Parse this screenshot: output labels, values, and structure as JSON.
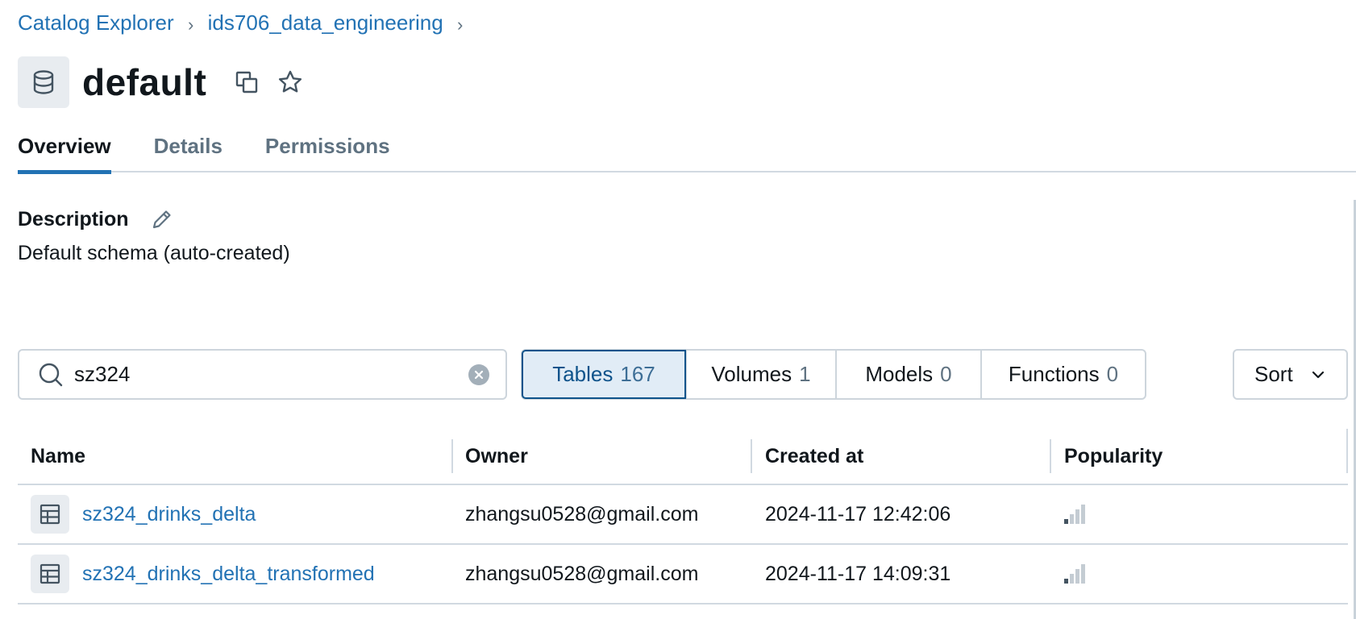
{
  "breadcrumb": {
    "items": [
      "Catalog Explorer",
      "ids706_data_engineering"
    ]
  },
  "header": {
    "title": "default",
    "icon": "database-icon",
    "actions": [
      "copy-icon",
      "star-icon"
    ]
  },
  "tabs": [
    {
      "label": "Overview",
      "active": true
    },
    {
      "label": "Details",
      "active": false
    },
    {
      "label": "Permissions",
      "active": false
    }
  ],
  "description": {
    "heading": "Description",
    "text": "Default schema (auto-created)"
  },
  "search": {
    "value": "sz324",
    "placeholder": ""
  },
  "filters": [
    {
      "label": "Tables",
      "count": "167",
      "active": true
    },
    {
      "label": "Volumes",
      "count": "1",
      "active": false
    },
    {
      "label": "Models",
      "count": "0",
      "active": false
    },
    {
      "label": "Functions",
      "count": "0",
      "active": false
    }
  ],
  "sort": {
    "label": "Sort"
  },
  "table": {
    "columns": [
      "Name",
      "Owner",
      "Created at",
      "Popularity"
    ],
    "rows": [
      {
        "name": "sz324_drinks_delta",
        "owner": "zhangsu0528@gmail.com",
        "created_at": "2024-11-17 12:42:06",
        "popularity": 1
      },
      {
        "name": "sz324_drinks_delta_transformed",
        "owner": "zhangsu0528@gmail.com",
        "created_at": "2024-11-17 14:09:31",
        "popularity": 1
      }
    ]
  },
  "colors": {
    "link": "#2272b4",
    "accent": "#0e538b",
    "active_bg": "#e1ecf6",
    "border": "#cdd5dc",
    "muted": "#5f7281"
  }
}
